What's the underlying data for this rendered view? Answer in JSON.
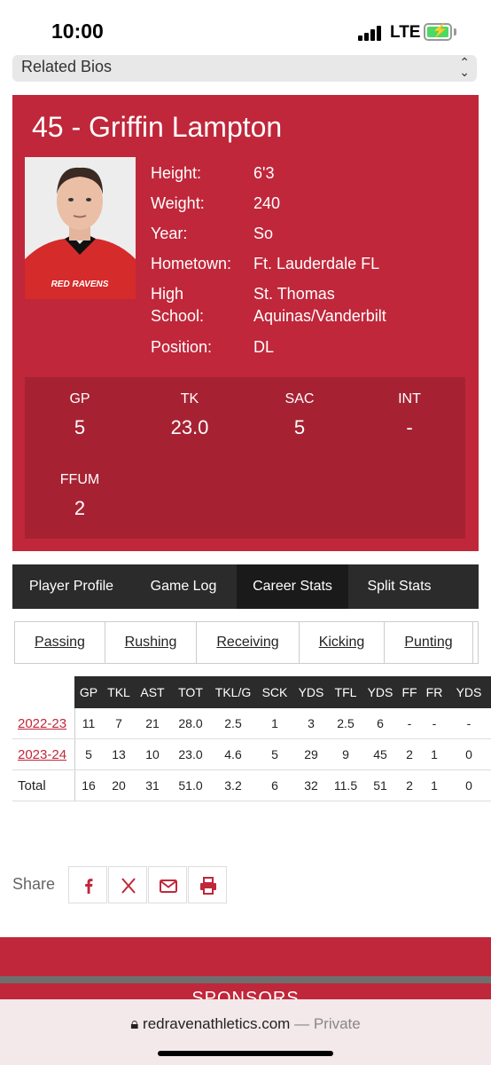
{
  "status_bar": {
    "time": "10:00",
    "network": "LTE"
  },
  "related_bios": {
    "label": "Related Bios"
  },
  "player": {
    "title": "45 - Griffin Lampton",
    "photo_jersey_text": "RED RAVENS",
    "bio": [
      {
        "label": "Height:",
        "value": "6'3"
      },
      {
        "label": "Weight:",
        "value": "240"
      },
      {
        "label": "Year:",
        "value": "So"
      },
      {
        "label": "Hometown:",
        "value": "Ft. Lauderdale FL"
      },
      {
        "label_line1": "High",
        "label_line2": "School:",
        "value_line1": "St. Thomas",
        "value_line2": "Aquinas/Vanderbilt"
      },
      {
        "label": "Position:",
        "value": "DL"
      }
    ],
    "summary_stats": [
      {
        "label": "GP",
        "value": "5"
      },
      {
        "label": "TK",
        "value": "23.0"
      },
      {
        "label": "SAC",
        "value": "5"
      },
      {
        "label": "INT",
        "value": "-"
      },
      {
        "label": "FFUM",
        "value": "2"
      }
    ]
  },
  "tabs": [
    {
      "label": "Player Profile"
    },
    {
      "label": "Game Log"
    },
    {
      "label": "Career Stats"
    },
    {
      "label": "Split Stats"
    }
  ],
  "active_tab": "Career Stats",
  "subtabs": [
    {
      "label": "Passing"
    },
    {
      "label": "Rushing"
    },
    {
      "label": "Receiving"
    },
    {
      "label": "Kicking"
    },
    {
      "label": "Punting"
    }
  ],
  "career_table": {
    "headers": [
      "GP",
      "TKL",
      "AST",
      "TOT",
      "TKL/G",
      "SCK",
      "YDS",
      "TFL",
      "YDS",
      "FF",
      "FR",
      "YDS"
    ],
    "rows": [
      {
        "season": "2022-23",
        "values": [
          "11",
          "7",
          "21",
          "28.0",
          "2.5",
          "1",
          "3",
          "2.5",
          "6",
          "-",
          "-",
          "-"
        ]
      },
      {
        "season": "2023-24",
        "values": [
          "5",
          "13",
          "10",
          "23.0",
          "4.6",
          "5",
          "29",
          "9",
          "45",
          "2",
          "1",
          "0"
        ]
      },
      {
        "season": "Total",
        "values": [
          "16",
          "20",
          "31",
          "51.0",
          "3.2",
          "6",
          "32",
          "11.5",
          "51",
          "2",
          "1",
          "0"
        ]
      }
    ]
  },
  "share": {
    "label": "Share"
  },
  "footer": {
    "sponsors": "SPONSORS"
  },
  "url_bar": {
    "domain": "redravenathletics.com",
    "mode": "— Private"
  },
  "colors": {
    "brand_red": "#c0273a",
    "dark_red": "#a62233",
    "tab_dark": "#2b2b2b"
  }
}
